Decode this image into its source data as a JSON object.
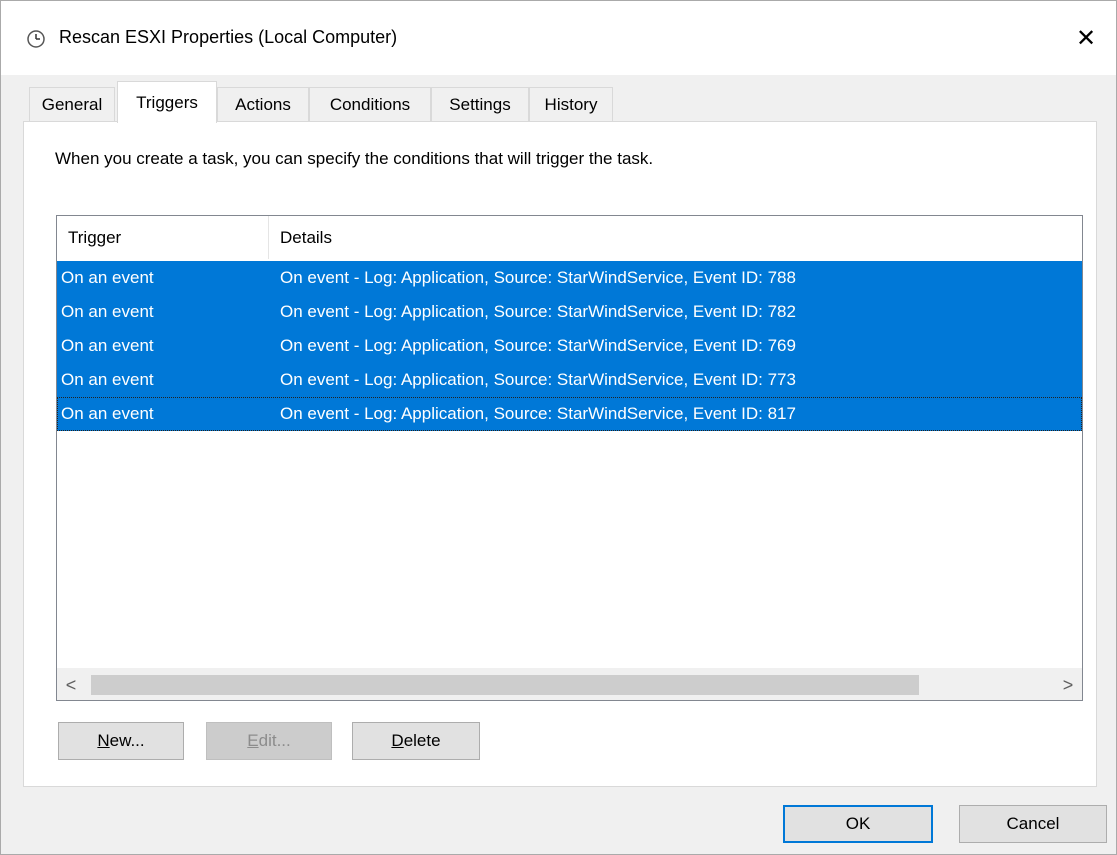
{
  "window": {
    "title": "Rescan ESXI Properties (Local Computer)",
    "title_icon": "clock-icon",
    "close_glyph": "✕"
  },
  "tabs": [
    {
      "label": "General",
      "active": false
    },
    {
      "label": "Triggers",
      "active": true
    },
    {
      "label": "Actions",
      "active": false
    },
    {
      "label": "Conditions",
      "active": false
    },
    {
      "label": "Settings",
      "active": false
    },
    {
      "label": "History",
      "active": false
    }
  ],
  "triggers_panel": {
    "description": "When you create a task, you can specify the conditions that will trigger the task.",
    "columns": {
      "trigger": "Trigger",
      "details": "Details"
    },
    "rows": [
      {
        "trigger": "On an event",
        "details": "On event - Log: Application, Source: StarWindService, Event ID: 788"
      },
      {
        "trigger": "On an event",
        "details": "On event - Log: Application, Source: StarWindService, Event ID: 782"
      },
      {
        "trigger": "On an event",
        "details": "On event - Log: Application, Source: StarWindService, Event ID: 769"
      },
      {
        "trigger": "On an event",
        "details": "On event - Log: Application, Source: StarWindService, Event ID: 773"
      },
      {
        "trigger": "On an event",
        "details": "On event - Log: Application, Source: StarWindService, Event ID: 817"
      }
    ],
    "scroll_left": "<",
    "scroll_right": ">",
    "buttons": {
      "new": {
        "accel": "N",
        "rest": "ew..."
      },
      "edit": {
        "accel": "E",
        "rest": "dit..."
      },
      "delete": {
        "accel": "D",
        "rest": "elete"
      }
    }
  },
  "footer": {
    "ok": "OK",
    "cancel": "Cancel"
  },
  "colors": {
    "selection": "#0078d7",
    "dialog_bg": "#f0f0f0"
  }
}
